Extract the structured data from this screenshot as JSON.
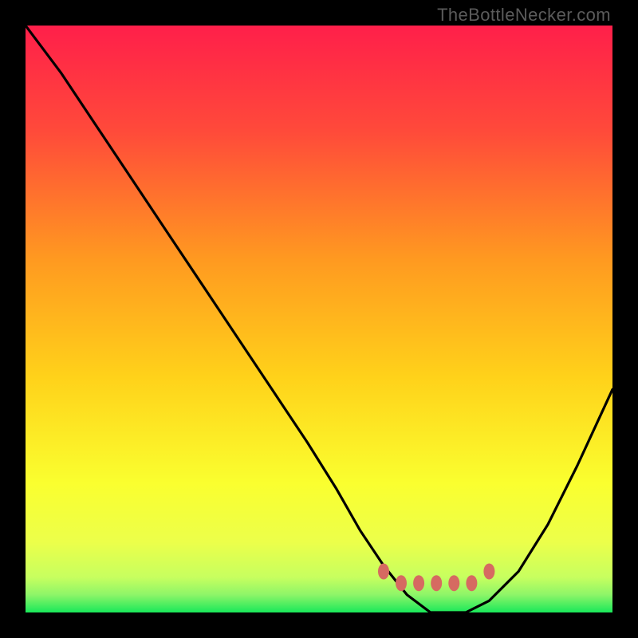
{
  "watermark": "TheBottleNecker.com",
  "colors": {
    "background": "#000000",
    "gradient_top": "#ff1f4a",
    "gradient_upper_mid": "#ff742f",
    "gradient_mid": "#ffd21a",
    "gradient_lower_mid": "#faff2f",
    "gradient_low": "#d7ff5a",
    "gradient_bottom": "#19e85a",
    "curve": "#000000",
    "marker_fill": "#d66a61",
    "marker_stroke": "#c94f45"
  },
  "chart_data": {
    "type": "line",
    "title": "",
    "xlabel": "",
    "ylabel": "",
    "xlim": [
      0,
      100
    ],
    "ylim": [
      0,
      100
    ],
    "annotations": [
      "TheBottleNecker.com"
    ],
    "series": [
      {
        "name": "bottleneck-curve",
        "x": [
          0,
          6,
          12,
          18,
          24,
          30,
          36,
          42,
          48,
          53,
          57,
          61,
          65,
          69,
          72,
          75,
          79,
          84,
          89,
          94,
          100
        ],
        "values": [
          100,
          92,
          83,
          74,
          65,
          56,
          47,
          38,
          29,
          21,
          14,
          8,
          3,
          0,
          0,
          0,
          2,
          7,
          15,
          25,
          38
        ]
      }
    ],
    "markers": [
      {
        "x": 61,
        "y": 7
      },
      {
        "x": 64,
        "y": 5
      },
      {
        "x": 67,
        "y": 5
      },
      {
        "x": 70,
        "y": 5
      },
      {
        "x": 73,
        "y": 5
      },
      {
        "x": 76,
        "y": 5
      },
      {
        "x": 79,
        "y": 7
      }
    ]
  }
}
